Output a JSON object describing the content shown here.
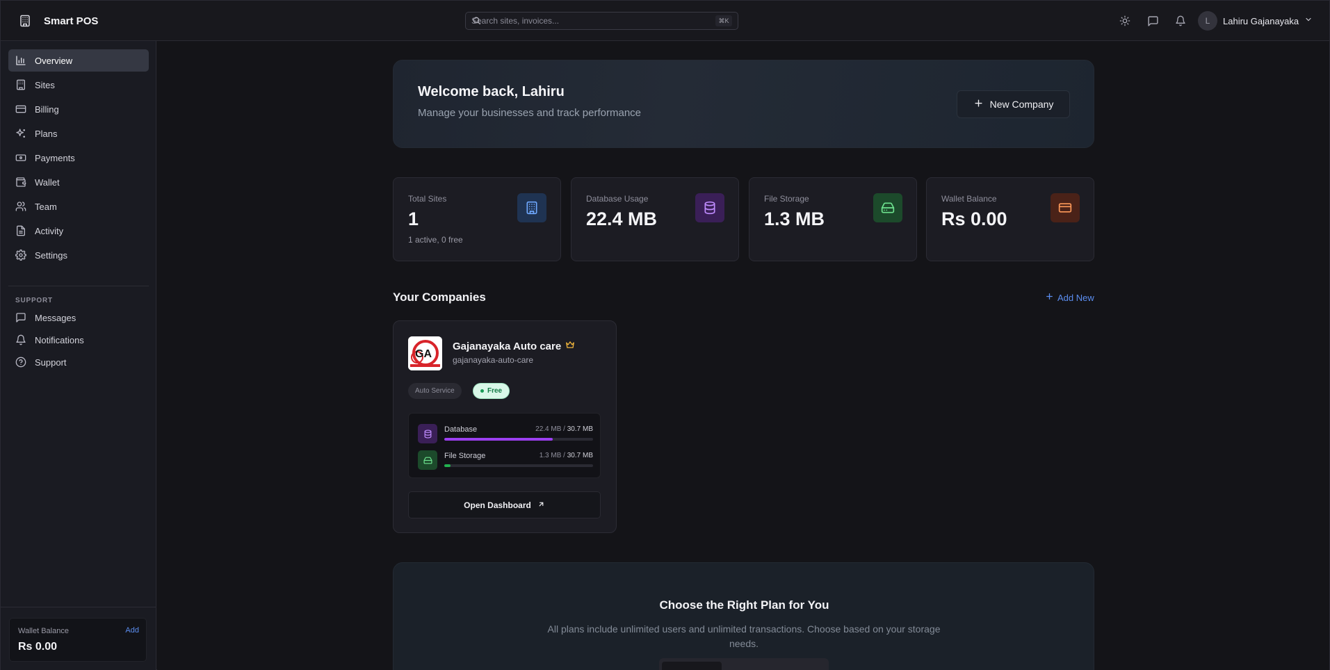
{
  "brand": {
    "name": "Smart POS"
  },
  "search": {
    "placeholder": "Search sites, invoices...",
    "shortcut": "⌘K"
  },
  "user": {
    "initial": "L",
    "name": "Lahiru Gajanayaka"
  },
  "sidebar": {
    "items": [
      {
        "label": "Overview",
        "icon": "bar-chart-icon",
        "active": true
      },
      {
        "label": "Sites",
        "icon": "building-icon"
      },
      {
        "label": "Billing",
        "icon": "credit-card-icon"
      },
      {
        "label": "Plans",
        "icon": "sparkles-icon"
      },
      {
        "label": "Payments",
        "icon": "banknote-icon"
      },
      {
        "label": "Wallet",
        "icon": "wallet-icon"
      },
      {
        "label": "Team",
        "icon": "users-icon"
      },
      {
        "label": "Activity",
        "icon": "file-text-icon"
      },
      {
        "label": "Settings",
        "icon": "gear-icon"
      }
    ],
    "support_label": "SUPPORT",
    "support_items": [
      {
        "label": "Messages",
        "icon": "message-icon"
      },
      {
        "label": "Notifications",
        "icon": "bell-icon"
      },
      {
        "label": "Support",
        "icon": "help-circle-icon"
      }
    ],
    "wallet": {
      "label": "Wallet Balance",
      "add_label": "Add",
      "value": "Rs 0.00"
    }
  },
  "hero": {
    "title": "Welcome back, Lahiru",
    "subtitle": "Manage your businesses and track performance",
    "button_label": "New Company"
  },
  "stats": [
    {
      "label": "Total Sites",
      "value": "1",
      "sub": "1 active, 0 free",
      "icon": "building-icon",
      "color": "#6fa8ff",
      "bg": "#1f3352"
    },
    {
      "label": "Database Usage",
      "value": "22.4 MB",
      "sub": "",
      "icon": "database-icon",
      "color": "#c08cff",
      "bg": "#3a1f57"
    },
    {
      "label": "File Storage",
      "value": "1.3 MB",
      "sub": "",
      "icon": "hard-drive-icon",
      "color": "#6ee38f",
      "bg": "#1c4a2b"
    },
    {
      "label": "Wallet Balance",
      "value": "Rs 0.00",
      "sub": "",
      "icon": "credit-card-icon",
      "color": "#ff9a5a",
      "bg": "#4a2218"
    }
  ],
  "companies": {
    "title": "Your Companies",
    "add_label": "Add New",
    "items": [
      {
        "name": "Gajanayaka Auto care",
        "slug": "gajanayaka-auto-care",
        "logo_text": "GA",
        "category": "Auto Service",
        "plan": "Free",
        "usage": [
          {
            "label": "Database",
            "used": "22.4 MB",
            "total": "30.7 MB",
            "fraction": 0.73,
            "color": "#9b3ff0",
            "icon": "database-icon",
            "icon_bg": "#3a1f57",
            "icon_color": "#c08cff"
          },
          {
            "label": "File Storage",
            "used": "1.3 MB",
            "total": "30.7 MB",
            "fraction": 0.04,
            "color": "#22b04f",
            "icon": "hard-drive-icon",
            "icon_bg": "#1c4a2b",
            "icon_color": "#6ee38f"
          }
        ],
        "open_label": "Open Dashboard"
      }
    ]
  },
  "plans": {
    "title": "Choose the Right Plan for You",
    "subtitle": "All plans include unlimited users and unlimited transactions. Choose based on your storage needs."
  }
}
